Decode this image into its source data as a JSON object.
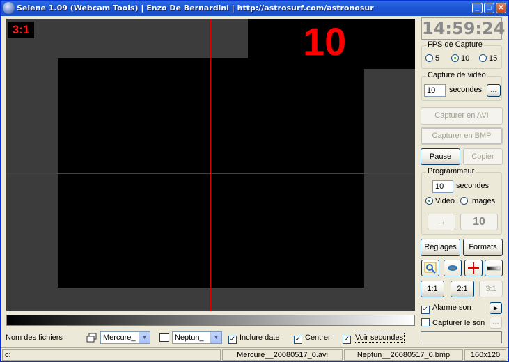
{
  "window": {
    "title": "Selene 1.09 (Webcam Tools) | Enzo De Bernardini | http://astrosurf.com/astronosur"
  },
  "video": {
    "ratio_label": "3:1",
    "countdown": "10"
  },
  "right_panel": {
    "clock": "14:59:24",
    "fps_group": {
      "title": "FPS de Capture",
      "options": [
        "5",
        "10",
        "15"
      ],
      "selected": "10"
    },
    "video_capture_group": {
      "title": "Capture de vidéo",
      "value": "10",
      "unit": "secondes",
      "browse_label": "..."
    },
    "capture_avi_label": "Capturer en AVI",
    "capture_bmp_label": "Capturer en BMP",
    "pause_label": "Pause",
    "copy_label": "Copier",
    "programmer_group": {
      "title": "Programmeur",
      "value": "10",
      "unit": "secondes",
      "options": [
        "Vidéo",
        "Images"
      ],
      "selected": "Vidéo",
      "go_arrow": "→",
      "counter": "10"
    },
    "settings_label": "Réglages",
    "formats_label": "Formats",
    "zoom_buttons": [
      "1:1",
      "2:1",
      "3:1"
    ],
    "alarm_label": "Alarme son",
    "alarm_arrow": "▶",
    "capture_sound_label": "Capturer le son",
    "capture_sound_browse": "..."
  },
  "bottom_bar": {
    "filenames_label": "Nom des fichiers",
    "combo1_value": "Mercure_",
    "combo2_value": "Neptun_",
    "include_date_label": "Inclure date",
    "center_label": "Centrer",
    "show_seconds_label": "Voir secondes"
  },
  "status_bar": {
    "drive": "c:",
    "avi_file": "Mercure__20080517_0.avi",
    "bmp_file": "Neptun__20080517_0.bmp",
    "resolution": "160x120"
  },
  "colors": {
    "titlebar": "#1c55d4",
    "window_bg": "#ece9d8",
    "crosshair": "#e00000",
    "countdown": "#ff0000"
  }
}
